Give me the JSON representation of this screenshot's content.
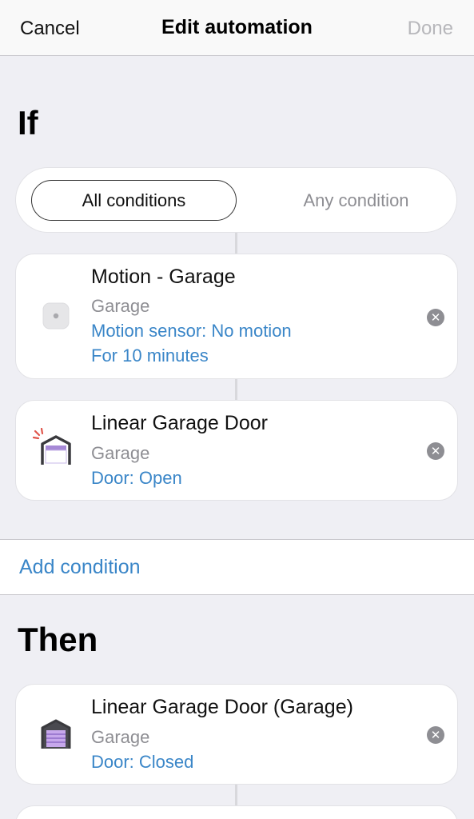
{
  "header": {
    "cancel_label": "Cancel",
    "title": "Edit automation",
    "done_label": "Done"
  },
  "if_section": {
    "title": "If",
    "segment": {
      "options": [
        "All conditions",
        "Any condition"
      ],
      "selected": "All conditions"
    },
    "conditions": [
      {
        "device": "Motion - Garage",
        "location": "Garage",
        "state": "Motion sensor: No motion",
        "duration": "For 10 minutes",
        "icon": "motion-sensor-icon"
      },
      {
        "device": "Linear Garage Door",
        "location": "Garage",
        "state": "Door: Open",
        "icon": "garage-door-open-icon"
      }
    ],
    "add_label": "Add condition"
  },
  "then_section": {
    "title": "Then",
    "actions": [
      {
        "device": "Linear Garage Door (Garage)",
        "location": "Garage",
        "state": "Door: Closed",
        "icon": "garage-door-closed-icon"
      }
    ]
  },
  "colors": {
    "link": "#3a86c8",
    "background": "#efeff4",
    "disabled": "#b7b7bb"
  }
}
